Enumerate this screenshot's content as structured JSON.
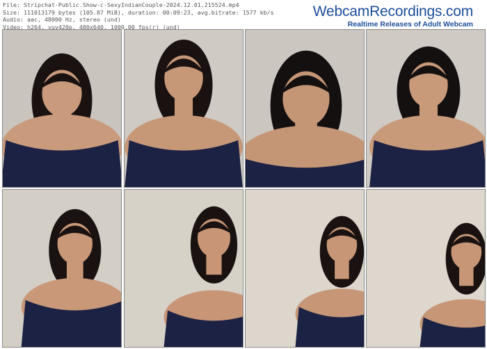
{
  "header": {
    "file": "File: Stripchat-Public.Show-c-SexyIndianCouple-2024.12.01.215524.mp4",
    "size": "Size: 111013179 bytes (105.87 MiB), duration: 00:09:23, avg.bitrate: 1577 kb/s",
    "audio": "Audio: aac, 48000 Hz, stereo (und)",
    "video": "Video: h264, yuv420p, 480x640, 1000.00 fps(r) (und)"
  },
  "brand": {
    "title": "WebcamRecordings.com",
    "subtitle": "Realtime Releases of Adult Webcam Recordings"
  },
  "thumbnails": [
    {
      "id": "frame-1",
      "bg": "#c9c5be",
      "skin": "#c99a7c",
      "hair": "#1a1210",
      "dress": "#1c2244"
    },
    {
      "id": "frame-2",
      "bg": "#cfcac3",
      "skin": "#c79878",
      "hair": "#1a1210",
      "dress": "#1c2244"
    },
    {
      "id": "frame-3",
      "bg": "#cbc6bf",
      "skin": "#c59676",
      "hair": "#151010",
      "dress": "#1c2244"
    },
    {
      "id": "frame-4",
      "bg": "#cfcac4",
      "skin": "#c99a7a",
      "hair": "#151010",
      "dress": "#1c2244"
    },
    {
      "id": "frame-5",
      "bg": "#d3cec6",
      "skin": "#c89878",
      "hair": "#1a1210",
      "dress": "#1c2244"
    },
    {
      "id": "frame-6",
      "bg": "#d7d2c8",
      "skin": "#c89676",
      "hair": "#1a1210",
      "dress": "#1c2244"
    },
    {
      "id": "frame-7",
      "bg": "#dcd6cc",
      "skin": "#c69676",
      "hair": "#1a1210",
      "dress": "#1c2244"
    },
    {
      "id": "frame-8",
      "bg": "#ddd7cd",
      "skin": "#c69676",
      "hair": "#1a1210",
      "dress": "#1c2244"
    }
  ]
}
